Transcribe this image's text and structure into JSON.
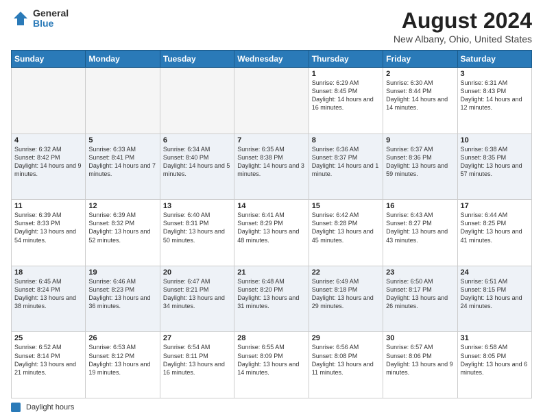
{
  "logo": {
    "general": "General",
    "blue": "Blue"
  },
  "header": {
    "title": "August 2024",
    "subtitle": "New Albany, Ohio, United States"
  },
  "days_of_week": [
    "Sunday",
    "Monday",
    "Tuesday",
    "Wednesday",
    "Thursday",
    "Friday",
    "Saturday"
  ],
  "footer": {
    "legend_label": "Daylight hours"
  },
  "weeks": [
    [
      {
        "day": "",
        "info": ""
      },
      {
        "day": "",
        "info": ""
      },
      {
        "day": "",
        "info": ""
      },
      {
        "day": "",
        "info": ""
      },
      {
        "day": "1",
        "info": "Sunrise: 6:29 AM\nSunset: 8:45 PM\nDaylight: 14 hours and 16 minutes."
      },
      {
        "day": "2",
        "info": "Sunrise: 6:30 AM\nSunset: 8:44 PM\nDaylight: 14 hours and 14 minutes."
      },
      {
        "day": "3",
        "info": "Sunrise: 6:31 AM\nSunset: 8:43 PM\nDaylight: 14 hours and 12 minutes."
      }
    ],
    [
      {
        "day": "4",
        "info": "Sunrise: 6:32 AM\nSunset: 8:42 PM\nDaylight: 14 hours and 9 minutes."
      },
      {
        "day": "5",
        "info": "Sunrise: 6:33 AM\nSunset: 8:41 PM\nDaylight: 14 hours and 7 minutes."
      },
      {
        "day": "6",
        "info": "Sunrise: 6:34 AM\nSunset: 8:40 PM\nDaylight: 14 hours and 5 minutes."
      },
      {
        "day": "7",
        "info": "Sunrise: 6:35 AM\nSunset: 8:38 PM\nDaylight: 14 hours and 3 minutes."
      },
      {
        "day": "8",
        "info": "Sunrise: 6:36 AM\nSunset: 8:37 PM\nDaylight: 14 hours and 1 minute."
      },
      {
        "day": "9",
        "info": "Sunrise: 6:37 AM\nSunset: 8:36 PM\nDaylight: 13 hours and 59 minutes."
      },
      {
        "day": "10",
        "info": "Sunrise: 6:38 AM\nSunset: 8:35 PM\nDaylight: 13 hours and 57 minutes."
      }
    ],
    [
      {
        "day": "11",
        "info": "Sunrise: 6:39 AM\nSunset: 8:33 PM\nDaylight: 13 hours and 54 minutes."
      },
      {
        "day": "12",
        "info": "Sunrise: 6:39 AM\nSunset: 8:32 PM\nDaylight: 13 hours and 52 minutes."
      },
      {
        "day": "13",
        "info": "Sunrise: 6:40 AM\nSunset: 8:31 PM\nDaylight: 13 hours and 50 minutes."
      },
      {
        "day": "14",
        "info": "Sunrise: 6:41 AM\nSunset: 8:29 PM\nDaylight: 13 hours and 48 minutes."
      },
      {
        "day": "15",
        "info": "Sunrise: 6:42 AM\nSunset: 8:28 PM\nDaylight: 13 hours and 45 minutes."
      },
      {
        "day": "16",
        "info": "Sunrise: 6:43 AM\nSunset: 8:27 PM\nDaylight: 13 hours and 43 minutes."
      },
      {
        "day": "17",
        "info": "Sunrise: 6:44 AM\nSunset: 8:25 PM\nDaylight: 13 hours and 41 minutes."
      }
    ],
    [
      {
        "day": "18",
        "info": "Sunrise: 6:45 AM\nSunset: 8:24 PM\nDaylight: 13 hours and 38 minutes."
      },
      {
        "day": "19",
        "info": "Sunrise: 6:46 AM\nSunset: 8:23 PM\nDaylight: 13 hours and 36 minutes."
      },
      {
        "day": "20",
        "info": "Sunrise: 6:47 AM\nSunset: 8:21 PM\nDaylight: 13 hours and 34 minutes."
      },
      {
        "day": "21",
        "info": "Sunrise: 6:48 AM\nSunset: 8:20 PM\nDaylight: 13 hours and 31 minutes."
      },
      {
        "day": "22",
        "info": "Sunrise: 6:49 AM\nSunset: 8:18 PM\nDaylight: 13 hours and 29 minutes."
      },
      {
        "day": "23",
        "info": "Sunrise: 6:50 AM\nSunset: 8:17 PM\nDaylight: 13 hours and 26 minutes."
      },
      {
        "day": "24",
        "info": "Sunrise: 6:51 AM\nSunset: 8:15 PM\nDaylight: 13 hours and 24 minutes."
      }
    ],
    [
      {
        "day": "25",
        "info": "Sunrise: 6:52 AM\nSunset: 8:14 PM\nDaylight: 13 hours and 21 minutes."
      },
      {
        "day": "26",
        "info": "Sunrise: 6:53 AM\nSunset: 8:12 PM\nDaylight: 13 hours and 19 minutes."
      },
      {
        "day": "27",
        "info": "Sunrise: 6:54 AM\nSunset: 8:11 PM\nDaylight: 13 hours and 16 minutes."
      },
      {
        "day": "28",
        "info": "Sunrise: 6:55 AM\nSunset: 8:09 PM\nDaylight: 13 hours and 14 minutes."
      },
      {
        "day": "29",
        "info": "Sunrise: 6:56 AM\nSunset: 8:08 PM\nDaylight: 13 hours and 11 minutes."
      },
      {
        "day": "30",
        "info": "Sunrise: 6:57 AM\nSunset: 8:06 PM\nDaylight: 13 hours and 9 minutes."
      },
      {
        "day": "31",
        "info": "Sunrise: 6:58 AM\nSunset: 8:05 PM\nDaylight: 13 hours and 6 minutes."
      }
    ]
  ]
}
